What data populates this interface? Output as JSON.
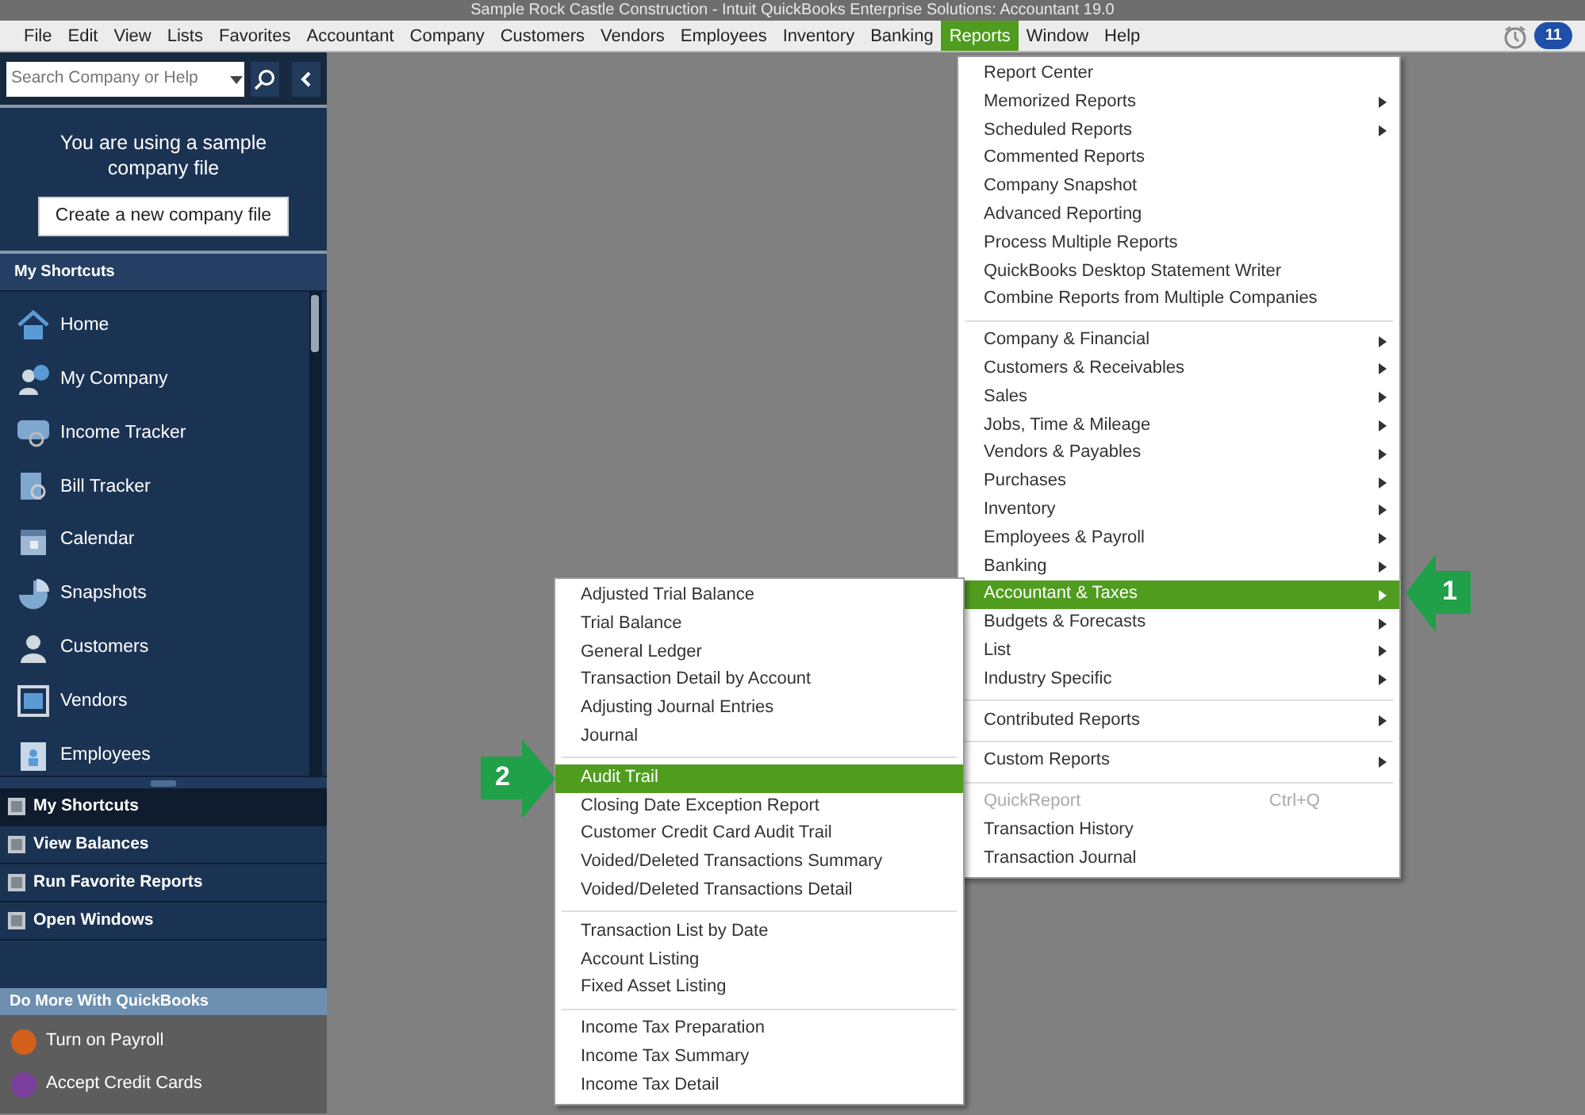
{
  "window": {
    "title": "Sample Rock Castle Construction  - Intuit QuickBooks Enterprise Solutions: Accountant 19.0"
  },
  "menu_bar": [
    {
      "label": "File",
      "selected": false
    },
    {
      "label": "Edit",
      "selected": false
    },
    {
      "label": "View",
      "selected": false
    },
    {
      "label": "Lists",
      "selected": false
    },
    {
      "label": "Favorites",
      "selected": false
    },
    {
      "label": "Accountant",
      "selected": false
    },
    {
      "label": "Company",
      "selected": false
    },
    {
      "label": "Customers",
      "selected": false
    },
    {
      "label": "Vendors",
      "selected": false
    },
    {
      "label": "Employees",
      "selected": false
    },
    {
      "label": "Inventory",
      "selected": false
    },
    {
      "label": "Banking",
      "selected": false
    },
    {
      "label": "Reports",
      "selected": true
    },
    {
      "label": "Window",
      "selected": false
    },
    {
      "label": "Help",
      "selected": false
    }
  ],
  "notifications": {
    "count": "11"
  },
  "sidebar": {
    "search": {
      "placeholder": "Search Company or Help"
    },
    "notice": {
      "text": "You are using a sample company file",
      "button": "Create a new company file"
    },
    "shortcuts_title": "My Shortcuts",
    "shortcuts": [
      {
        "label": "Home",
        "kind": "home"
      },
      {
        "label": "My Company",
        "kind": "company"
      },
      {
        "label": "Income Tracker",
        "kind": "income"
      },
      {
        "label": "Bill Tracker",
        "kind": "bill"
      },
      {
        "label": "Calendar",
        "kind": "calendar"
      },
      {
        "label": "Snapshots",
        "kind": "snapshots"
      },
      {
        "label": "Customers",
        "kind": "customers"
      },
      {
        "label": "Vendors",
        "kind": "vendors"
      },
      {
        "label": "Employees",
        "kind": "employees"
      }
    ],
    "nav": [
      {
        "label": "My Shortcuts",
        "selected": true
      },
      {
        "label": "View Balances",
        "selected": false
      },
      {
        "label": "Run Favorite Reports",
        "selected": false
      },
      {
        "label": "Open Windows",
        "selected": false
      }
    ],
    "more_title": "Do More With QuickBooks",
    "more": [
      {
        "label": "Turn on Payroll",
        "color": "#d2601a"
      },
      {
        "label": "Accept Credit Cards",
        "color": "#7b3f9e"
      }
    ]
  },
  "reports_menu": [
    {
      "kind": "item",
      "label": "Report Center",
      "submenu": false,
      "selected": false,
      "disabled": false
    },
    {
      "kind": "item",
      "label": "Memorized Reports",
      "submenu": true,
      "selected": false,
      "disabled": false
    },
    {
      "kind": "item",
      "label": "Scheduled Reports",
      "submenu": true,
      "selected": false,
      "disabled": false
    },
    {
      "kind": "item",
      "label": "Commented Reports",
      "submenu": false,
      "selected": false,
      "disabled": false
    },
    {
      "kind": "item",
      "label": "Company Snapshot",
      "submenu": false,
      "selected": false,
      "disabled": false
    },
    {
      "kind": "item",
      "label": "Advanced Reporting",
      "submenu": false,
      "selected": false,
      "disabled": false
    },
    {
      "kind": "item",
      "label": "Process Multiple Reports",
      "submenu": false,
      "selected": false,
      "disabled": false
    },
    {
      "kind": "item",
      "label": "QuickBooks Desktop Statement Writer",
      "submenu": false,
      "selected": false,
      "disabled": false
    },
    {
      "kind": "item",
      "label": "Combine Reports from Multiple Companies",
      "submenu": false,
      "selected": false,
      "disabled": false
    },
    {
      "kind": "separator"
    },
    {
      "kind": "item",
      "label": "Company & Financial",
      "submenu": true,
      "selected": false,
      "disabled": false
    },
    {
      "kind": "item",
      "label": "Customers & Receivables",
      "submenu": true,
      "selected": false,
      "disabled": false
    },
    {
      "kind": "item",
      "label": "Sales",
      "submenu": true,
      "selected": false,
      "disabled": false
    },
    {
      "kind": "item",
      "label": "Jobs, Time & Mileage",
      "submenu": true,
      "selected": false,
      "disabled": false
    },
    {
      "kind": "item",
      "label": "Vendors & Payables",
      "submenu": true,
      "selected": false,
      "disabled": false
    },
    {
      "kind": "item",
      "label": "Purchases",
      "submenu": true,
      "selected": false,
      "disabled": false
    },
    {
      "kind": "item",
      "label": "Inventory",
      "submenu": true,
      "selected": false,
      "disabled": false
    },
    {
      "kind": "item",
      "label": "Employees & Payroll",
      "submenu": true,
      "selected": false,
      "disabled": false
    },
    {
      "kind": "item",
      "label": "Banking",
      "submenu": true,
      "selected": false,
      "disabled": false
    },
    {
      "kind": "item",
      "label": "Accountant & Taxes",
      "submenu": true,
      "selected": true,
      "disabled": false
    },
    {
      "kind": "item",
      "label": "Budgets & Forecasts",
      "submenu": true,
      "selected": false,
      "disabled": false
    },
    {
      "kind": "item",
      "label": "List",
      "submenu": true,
      "selected": false,
      "disabled": false
    },
    {
      "kind": "item",
      "label": "Industry Specific",
      "submenu": true,
      "selected": false,
      "disabled": false
    },
    {
      "kind": "separator"
    },
    {
      "kind": "item",
      "label": "Contributed Reports",
      "submenu": true,
      "selected": false,
      "disabled": false
    },
    {
      "kind": "separator"
    },
    {
      "kind": "item",
      "label": "Custom Reports",
      "submenu": true,
      "selected": false,
      "disabled": false
    },
    {
      "kind": "separator"
    },
    {
      "kind": "item",
      "label": "QuickReport",
      "shortcut": "Ctrl+Q",
      "submenu": false,
      "selected": false,
      "disabled": true
    },
    {
      "kind": "item",
      "label": "Transaction History",
      "submenu": false,
      "selected": false,
      "disabled": false
    },
    {
      "kind": "item",
      "label": "Transaction Journal",
      "submenu": false,
      "selected": false,
      "disabled": false
    }
  ],
  "accountant_taxes_menu": [
    {
      "kind": "item",
      "label": "Adjusted Trial Balance",
      "selected": false
    },
    {
      "kind": "item",
      "label": "Trial Balance",
      "selected": false
    },
    {
      "kind": "item",
      "label": "General Ledger",
      "selected": false
    },
    {
      "kind": "item",
      "label": "Transaction Detail by Account",
      "selected": false
    },
    {
      "kind": "item",
      "label": "Adjusting Journal Entries",
      "selected": false
    },
    {
      "kind": "item",
      "label": "Journal",
      "selected": false
    },
    {
      "kind": "separator"
    },
    {
      "kind": "item",
      "label": "Audit Trail",
      "selected": true
    },
    {
      "kind": "item",
      "label": "Closing Date Exception Report",
      "selected": false
    },
    {
      "kind": "item",
      "label": "Customer Credit Card Audit Trail",
      "selected": false
    },
    {
      "kind": "item",
      "label": "Voided/Deleted Transactions Summary",
      "selected": false
    },
    {
      "kind": "item",
      "label": "Voided/Deleted Transactions Detail",
      "selected": false
    },
    {
      "kind": "separator"
    },
    {
      "kind": "item",
      "label": "Transaction List by Date",
      "selected": false
    },
    {
      "kind": "item",
      "label": "Account Listing",
      "selected": false
    },
    {
      "kind": "item",
      "label": "Fixed Asset Listing",
      "selected": false
    },
    {
      "kind": "separator"
    },
    {
      "kind": "item",
      "label": "Income Tax Preparation",
      "selected": false
    },
    {
      "kind": "item",
      "label": "Income Tax Summary",
      "selected": false
    },
    {
      "kind": "item",
      "label": "Income Tax Detail",
      "selected": false
    }
  ],
  "callouts": [
    {
      "number": "1",
      "kind": "left"
    },
    {
      "number": "2",
      "kind": "right"
    }
  ]
}
